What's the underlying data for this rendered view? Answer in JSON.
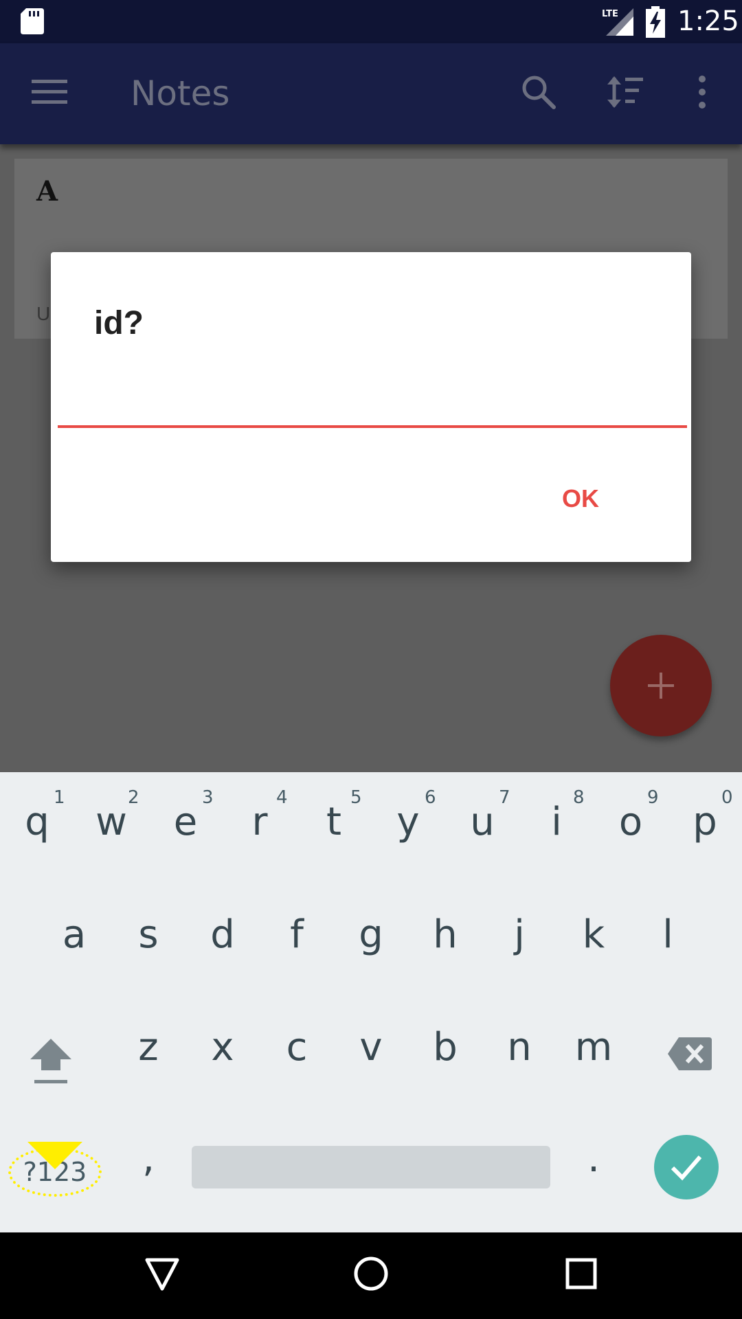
{
  "status_bar": {
    "time": "1:25",
    "network_label": "LTE",
    "icons": [
      "sd-card-icon",
      "lte-signal-icon",
      "battery-charging-icon"
    ]
  },
  "app_bar": {
    "title": "Notes",
    "icons": [
      "menu-icon",
      "search-icon",
      "sort-icon",
      "more-vert-icon"
    ]
  },
  "note": {
    "title": "A",
    "subtitle_partial": "U"
  },
  "dialog": {
    "title": "id?",
    "input_value": "",
    "ok_label": "OK"
  },
  "keyboard": {
    "row1_hints": [
      "1",
      "2",
      "3",
      "4",
      "5",
      "6",
      "7",
      "8",
      "9",
      "0"
    ],
    "row1": [
      "q",
      "w",
      "e",
      "r",
      "t",
      "y",
      "u",
      "i",
      "o",
      "p"
    ],
    "row2": [
      "a",
      "s",
      "d",
      "f",
      "g",
      "h",
      "j",
      "k",
      "l"
    ],
    "row3": [
      "z",
      "x",
      "c",
      "v",
      "b",
      "n",
      "m"
    ],
    "symbols_label": "?123",
    "comma": ",",
    "period": "."
  },
  "colors": {
    "status_bar": "#0f1434",
    "app_bar": "#181e46",
    "accent": "#e84a45",
    "fab": "#6b1f1c",
    "enter_key": "#4db6ac",
    "keyboard_bg": "#eceff1",
    "highlight": "#ffee00"
  }
}
